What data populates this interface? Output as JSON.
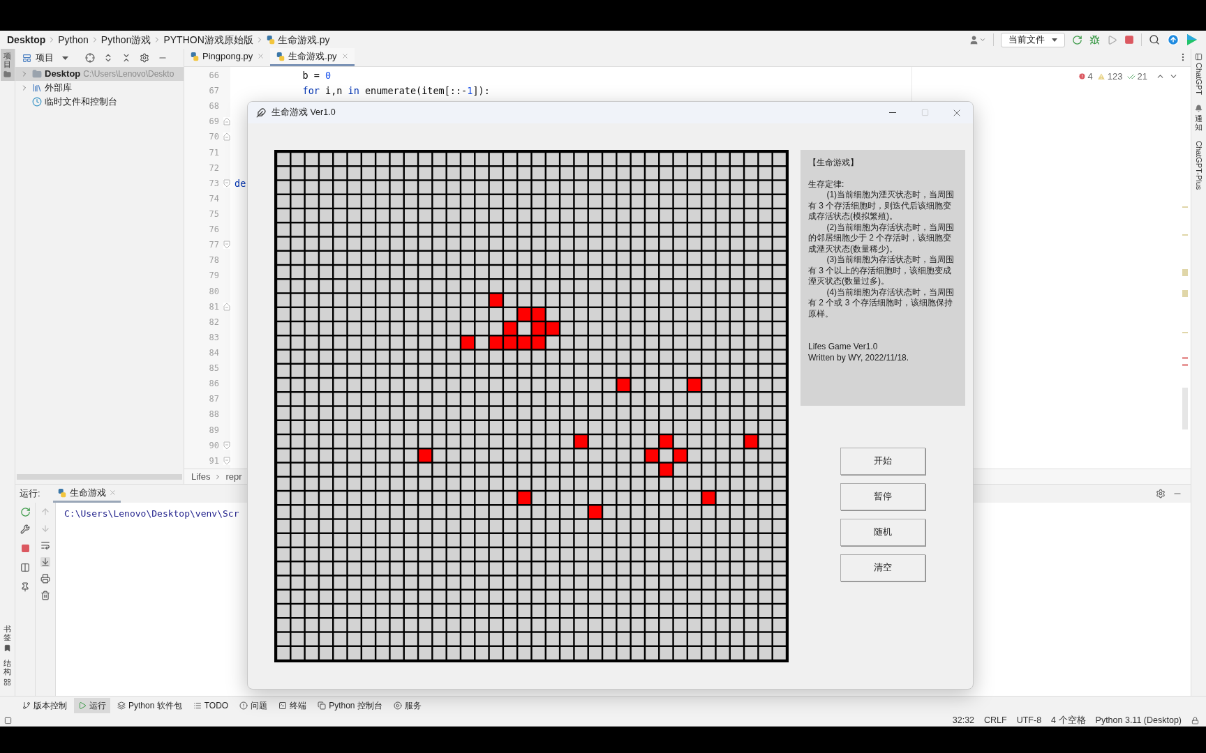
{
  "breadcrumb": [
    {
      "label": "Desktop"
    },
    {
      "label": "Python"
    },
    {
      "label": "Python游戏"
    },
    {
      "label": "PYTHON游戏原始版"
    },
    {
      "label": "生命游戏.py"
    }
  ],
  "toolbar": {
    "run_config": "当前文件"
  },
  "left_strip": {
    "top": [
      {
        "label": "项目",
        "selected": true
      }
    ],
    "bottom": [
      {
        "label": "书签"
      },
      {
        "label": "结构"
      }
    ]
  },
  "right_strip": [
    {
      "label": "ChatGPT",
      "kind": "rotated"
    },
    {
      "label": "通知",
      "kind": "stacked"
    },
    {
      "label": "ChatGPT-Plus",
      "kind": "rotated"
    }
  ],
  "project_panel": {
    "title": "项目",
    "tree": [
      {
        "label": "Desktop",
        "path": "C:\\Users\\Lenovo\\Deskto",
        "kind": "folder",
        "expanded": false,
        "selected": true
      },
      {
        "label": "外部库",
        "kind": "library",
        "expanded": false,
        "selected": false
      },
      {
        "label": "临时文件和控制台",
        "kind": "scratch",
        "selected": false
      }
    ]
  },
  "editor_tabs": [
    {
      "label": "Pingpong.py",
      "selected": false
    },
    {
      "label": "生命游戏.py",
      "selected": true
    }
  ],
  "inspections": {
    "errors": "4",
    "warnings": "123",
    "weak_warnings": "21"
  },
  "editor": {
    "lines": [
      {
        "number": "66",
        "tokens": [
          {
            "text": "            b = ",
            "kind": "plain"
          },
          {
            "text": "0",
            "kind": "number"
          }
        ]
      },
      {
        "number": "67",
        "tokens": [
          {
            "text": "            for ",
            "kind": "keyword"
          },
          {
            "text": "i,n ",
            "kind": "plain"
          },
          {
            "text": "in ",
            "kind": "keyword"
          },
          {
            "text": "enumerate(item[::-",
            "kind": "plain"
          },
          {
            "text": "1",
            "kind": "number"
          },
          {
            "text": "]):",
            "kind": "plain"
          }
        ]
      },
      {
        "number": "68"
      },
      {
        "number": "69",
        "fold_end": true
      },
      {
        "number": "70",
        "fold_end": true
      },
      {
        "number": "71"
      },
      {
        "number": "72"
      },
      {
        "number": "73",
        "fold_start": true,
        "tokens": [
          {
            "text": "de",
            "kind": "keyword"
          }
        ]
      },
      {
        "number": "74"
      },
      {
        "number": "75"
      },
      {
        "number": "76"
      },
      {
        "number": "77",
        "fold_start": true
      },
      {
        "number": "78"
      },
      {
        "number": "79"
      },
      {
        "number": "80"
      },
      {
        "number": "81",
        "fold_end": true
      },
      {
        "number": "82"
      },
      {
        "number": "83"
      },
      {
        "number": "84"
      },
      {
        "number": "85"
      },
      {
        "number": "86"
      },
      {
        "number": "87"
      },
      {
        "number": "88"
      },
      {
        "number": "89"
      },
      {
        "number": "90",
        "fold_start": true
      },
      {
        "number": "91",
        "fold_start": true
      }
    ],
    "breadcrumb": [
      "Lifes",
      "repr"
    ]
  },
  "run_panel": {
    "label": "运行:",
    "tab": "生命游戏",
    "output": "C:\\Users\\Lenovo\\Desktop\\venv\\Scr"
  },
  "tool_windows": [
    {
      "label": "版本控制",
      "selected": false
    },
    {
      "label": "运行",
      "selected": true
    },
    {
      "label": "Python 软件包",
      "selected": false
    },
    {
      "label": "TODO",
      "selected": false
    },
    {
      "label": "问题",
      "selected": false
    },
    {
      "label": "终端",
      "selected": false
    },
    {
      "label": "Python 控制台",
      "selected": false
    },
    {
      "label": "服务",
      "selected": false
    }
  ],
  "status_bar": [
    "32:32",
    "CRLF",
    "UTF-8",
    "4 个空格",
    "Python 3.11 (Desktop)"
  ],
  "dialog": {
    "title": "生命游戏 Ver1.0",
    "board": {
      "rows": [
        [
          false,
          false,
          false,
          false,
          false,
          false,
          false,
          false,
          false,
          false,
          false,
          false,
          false,
          false,
          false,
          false,
          false,
          false,
          false,
          false,
          false,
          false,
          false,
          false,
          false,
          false,
          false,
          false,
          false,
          false,
          false,
          false,
          false,
          false,
          false,
          false
        ],
        [
          false,
          false,
          false,
          false,
          false,
          false,
          false,
          false,
          false,
          false,
          false,
          false,
          false,
          false,
          false,
          false,
          false,
          false,
          false,
          false,
          false,
          false,
          false,
          false,
          false,
          false,
          false,
          false,
          false,
          false,
          false,
          false,
          false,
          false,
          false,
          false
        ],
        [
          false,
          false,
          false,
          false,
          false,
          false,
          false,
          false,
          false,
          false,
          false,
          false,
          false,
          false,
          false,
          false,
          false,
          false,
          false,
          false,
          false,
          false,
          false,
          false,
          false,
          false,
          false,
          false,
          false,
          false,
          false,
          false,
          false,
          false,
          false,
          false
        ],
        [
          false,
          false,
          false,
          false,
          false,
          false,
          false,
          false,
          false,
          false,
          false,
          false,
          false,
          false,
          false,
          false,
          false,
          false,
          false,
          false,
          false,
          false,
          false,
          false,
          false,
          false,
          false,
          false,
          false,
          false,
          false,
          false,
          false,
          false,
          false,
          false
        ],
        [
          false,
          false,
          false,
          false,
          false,
          false,
          false,
          false,
          false,
          false,
          false,
          false,
          false,
          false,
          false,
          false,
          false,
          false,
          false,
          false,
          false,
          false,
          false,
          false,
          false,
          false,
          false,
          false,
          false,
          false,
          false,
          false,
          false,
          false,
          false,
          false
        ],
        [
          false,
          false,
          false,
          false,
          false,
          false,
          false,
          false,
          false,
          false,
          false,
          false,
          false,
          false,
          false,
          false,
          false,
          false,
          false,
          false,
          false,
          false,
          false,
          false,
          false,
          false,
          false,
          false,
          false,
          false,
          false,
          false,
          false,
          false,
          false,
          false
        ],
        [
          false,
          false,
          false,
          false,
          false,
          false,
          false,
          false,
          false,
          false,
          false,
          false,
          false,
          false,
          false,
          false,
          false,
          false,
          false,
          false,
          false,
          false,
          false,
          false,
          false,
          false,
          false,
          false,
          false,
          false,
          false,
          false,
          false,
          false,
          false,
          false
        ],
        [
          false,
          false,
          false,
          false,
          false,
          false,
          false,
          false,
          false,
          false,
          false,
          false,
          false,
          false,
          false,
          false,
          false,
          false,
          false,
          false,
          false,
          false,
          false,
          false,
          false,
          false,
          false,
          false,
          false,
          false,
          false,
          false,
          false,
          false,
          false,
          false
        ],
        [
          false,
          false,
          false,
          false,
          false,
          false,
          false,
          false,
          false,
          false,
          false,
          false,
          false,
          false,
          false,
          false,
          false,
          false,
          false,
          false,
          false,
          false,
          false,
          false,
          false,
          false,
          false,
          false,
          false,
          false,
          false,
          false,
          false,
          false,
          false,
          false
        ],
        [
          false,
          false,
          false,
          false,
          false,
          false,
          false,
          false,
          false,
          false,
          false,
          false,
          false,
          false,
          false,
          false,
          false,
          false,
          false,
          false,
          false,
          false,
          false,
          false,
          false,
          false,
          false,
          false,
          false,
          false,
          false,
          false,
          false,
          false,
          false,
          false
        ],
        [
          false,
          false,
          false,
          false,
          false,
          false,
          false,
          false,
          false,
          false,
          false,
          false,
          false,
          false,
          false,
          true,
          false,
          false,
          false,
          false,
          false,
          false,
          false,
          false,
          false,
          false,
          false,
          false,
          false,
          false,
          false,
          false,
          false,
          false,
          false,
          false
        ],
        [
          false,
          false,
          false,
          false,
          false,
          false,
          false,
          false,
          false,
          false,
          false,
          false,
          false,
          false,
          false,
          false,
          false,
          true,
          true,
          false,
          false,
          false,
          false,
          false,
          false,
          false,
          false,
          false,
          false,
          false,
          false,
          false,
          false,
          false,
          false,
          false
        ],
        [
          false,
          false,
          false,
          false,
          false,
          false,
          false,
          false,
          false,
          false,
          false,
          false,
          false,
          false,
          false,
          false,
          true,
          false,
          true,
          true,
          false,
          false,
          false,
          false,
          false,
          false,
          false,
          false,
          false,
          false,
          false,
          false,
          false,
          false,
          false,
          false
        ],
        [
          false,
          false,
          false,
          false,
          false,
          false,
          false,
          false,
          false,
          false,
          false,
          false,
          false,
          true,
          false,
          true,
          true,
          true,
          true,
          false,
          false,
          false,
          false,
          false,
          false,
          false,
          false,
          false,
          false,
          false,
          false,
          false,
          false,
          false,
          false,
          false
        ],
        [
          false,
          false,
          false,
          false,
          false,
          false,
          false,
          false,
          false,
          false,
          false,
          false,
          false,
          false,
          false,
          false,
          false,
          false,
          false,
          false,
          false,
          false,
          false,
          false,
          false,
          false,
          false,
          false,
          false,
          false,
          false,
          false,
          false,
          false,
          false,
          false
        ],
        [
          false,
          false,
          false,
          false,
          false,
          false,
          false,
          false,
          false,
          false,
          false,
          false,
          false,
          false,
          false,
          false,
          false,
          false,
          false,
          false,
          false,
          false,
          false,
          false,
          false,
          false,
          false,
          false,
          false,
          false,
          false,
          false,
          false,
          false,
          false,
          false
        ],
        [
          false,
          false,
          false,
          false,
          false,
          false,
          false,
          false,
          false,
          false,
          false,
          false,
          false,
          false,
          false,
          false,
          false,
          false,
          false,
          false,
          false,
          false,
          false,
          false,
          true,
          false,
          false,
          false,
          false,
          true,
          false,
          false,
          false,
          false,
          false,
          false
        ],
        [
          false,
          false,
          false,
          false,
          false,
          false,
          false,
          false,
          false,
          false,
          false,
          false,
          false,
          false,
          false,
          false,
          false,
          false,
          false,
          false,
          false,
          false,
          false,
          false,
          false,
          false,
          false,
          false,
          false,
          false,
          false,
          false,
          false,
          false,
          false,
          false
        ],
        [
          false,
          false,
          false,
          false,
          false,
          false,
          false,
          false,
          false,
          false,
          false,
          false,
          false,
          false,
          false,
          false,
          false,
          false,
          false,
          false,
          false,
          false,
          false,
          false,
          false,
          false,
          false,
          false,
          false,
          false,
          false,
          false,
          false,
          false,
          false,
          false
        ],
        [
          false,
          false,
          false,
          false,
          false,
          false,
          false,
          false,
          false,
          false,
          false,
          false,
          false,
          false,
          false,
          false,
          false,
          false,
          false,
          false,
          false,
          false,
          false,
          false,
          false,
          false,
          false,
          false,
          false,
          false,
          false,
          false,
          false,
          false,
          false,
          false
        ],
        [
          false,
          false,
          false,
          false,
          false,
          false,
          false,
          false,
          false,
          false,
          false,
          false,
          false,
          false,
          false,
          false,
          false,
          false,
          false,
          false,
          false,
          true,
          false,
          false,
          false,
          false,
          false,
          true,
          false,
          false,
          false,
          false,
          false,
          true,
          false,
          false
        ],
        [
          false,
          false,
          false,
          false,
          false,
          false,
          false,
          false,
          false,
          false,
          true,
          false,
          false,
          false,
          false,
          false,
          false,
          false,
          false,
          false,
          false,
          false,
          false,
          false,
          false,
          false,
          true,
          false,
          true,
          false,
          false,
          false,
          false,
          false,
          false,
          false
        ],
        [
          false,
          false,
          false,
          false,
          false,
          false,
          false,
          false,
          false,
          false,
          false,
          false,
          false,
          false,
          false,
          false,
          false,
          false,
          false,
          false,
          false,
          false,
          false,
          false,
          false,
          false,
          false,
          true,
          false,
          false,
          false,
          false,
          false,
          false,
          false,
          false
        ],
        [
          false,
          false,
          false,
          false,
          false,
          false,
          false,
          false,
          false,
          false,
          false,
          false,
          false,
          false,
          false,
          false,
          false,
          false,
          false,
          false,
          false,
          false,
          false,
          false,
          false,
          false,
          false,
          false,
          false,
          false,
          false,
          false,
          false,
          false,
          false,
          false
        ],
        [
          false,
          false,
          false,
          false,
          false,
          false,
          false,
          false,
          false,
          false,
          false,
          false,
          false,
          false,
          false,
          false,
          false,
          true,
          false,
          false,
          false,
          false,
          false,
          false,
          false,
          false,
          false,
          false,
          false,
          false,
          true,
          false,
          false,
          false,
          false,
          false
        ],
        [
          false,
          false,
          false,
          false,
          false,
          false,
          false,
          false,
          false,
          false,
          false,
          false,
          false,
          false,
          false,
          false,
          false,
          false,
          false,
          false,
          false,
          false,
          true,
          false,
          false,
          false,
          false,
          false,
          false,
          false,
          false,
          false,
          false,
          false,
          false,
          false
        ],
        [
          false,
          false,
          false,
          false,
          false,
          false,
          false,
          false,
          false,
          false,
          false,
          false,
          false,
          false,
          false,
          false,
          false,
          false,
          false,
          false,
          false,
          false,
          false,
          false,
          false,
          false,
          false,
          false,
          false,
          false,
          false,
          false,
          false,
          false,
          false,
          false
        ],
        [
          false,
          false,
          false,
          false,
          false,
          false,
          false,
          false,
          false,
          false,
          false,
          false,
          false,
          false,
          false,
          false,
          false,
          false,
          false,
          false,
          false,
          false,
          false,
          false,
          false,
          false,
          false,
          false,
          false,
          false,
          false,
          false,
          false,
          false,
          false,
          false
        ],
        [
          false,
          false,
          false,
          false,
          false,
          false,
          false,
          false,
          false,
          false,
          false,
          false,
          false,
          false,
          false,
          false,
          false,
          false,
          false,
          false,
          false,
          false,
          false,
          false,
          false,
          false,
          false,
          false,
          false,
          false,
          false,
          false,
          false,
          false,
          false,
          false
        ],
        [
          false,
          false,
          false,
          false,
          false,
          false,
          false,
          false,
          false,
          false,
          false,
          false,
          false,
          false,
          false,
          false,
          false,
          false,
          false,
          false,
          false,
          false,
          false,
          false,
          false,
          false,
          false,
          false,
          false,
          false,
          false,
          false,
          false,
          false,
          false,
          false
        ],
        [
          false,
          false,
          false,
          false,
          false,
          false,
          false,
          false,
          false,
          false,
          false,
          false,
          false,
          false,
          false,
          false,
          false,
          false,
          false,
          false,
          false,
          false,
          false,
          false,
          false,
          false,
          false,
          false,
          false,
          false,
          false,
          false,
          false,
          false,
          false,
          false
        ],
        [
          false,
          false,
          false,
          false,
          false,
          false,
          false,
          false,
          false,
          false,
          false,
          false,
          false,
          false,
          false,
          false,
          false,
          false,
          false,
          false,
          false,
          false,
          false,
          false,
          false,
          false,
          false,
          false,
          false,
          false,
          false,
          false,
          false,
          false,
          false,
          false
        ],
        [
          false,
          false,
          false,
          false,
          false,
          false,
          false,
          false,
          false,
          false,
          false,
          false,
          false,
          false,
          false,
          false,
          false,
          false,
          false,
          false,
          false,
          false,
          false,
          false,
          false,
          false,
          false,
          false,
          false,
          false,
          false,
          false,
          false,
          false,
          false,
          false
        ],
        [
          false,
          false,
          false,
          false,
          false,
          false,
          false,
          false,
          false,
          false,
          false,
          false,
          false,
          false,
          false,
          false,
          false,
          false,
          false,
          false,
          false,
          false,
          false,
          false,
          false,
          false,
          false,
          false,
          false,
          false,
          false,
          false,
          false,
          false,
          false,
          false
        ],
        [
          false,
          false,
          false,
          false,
          false,
          false,
          false,
          false,
          false,
          false,
          false,
          false,
          false,
          false,
          false,
          false,
          false,
          false,
          false,
          false,
          false,
          false,
          false,
          false,
          false,
          false,
          false,
          false,
          false,
          false,
          false,
          false,
          false,
          false,
          false,
          false
        ],
        [
          false,
          false,
          false,
          false,
          false,
          false,
          false,
          false,
          false,
          false,
          false,
          false,
          false,
          false,
          false,
          false,
          false,
          false,
          false,
          false,
          false,
          false,
          false,
          false,
          false,
          false,
          false,
          false,
          false,
          false,
          false,
          false,
          false,
          false,
          false,
          false
        ]
      ]
    },
    "info": {
      "heading": "【生命游戏】",
      "subheading": "生存定律:",
      "rules": [
        "(1)当前细胞为湮灭状态时，当周围有 3 个存活细胞时，则迭代后该细胞变成存活状态(模拟繁殖)。",
        "(2)当前细胞为存活状态时，当周围的邻居细胞少于 2 个存活时，该细胞变成湮灭状态(数量稀少)。",
        "(3)当前细胞为存活状态时，当周围有 3 个以上的存活细胞时，该细胞变成湮灭状态(数量过多)。",
        "(4)当前细胞为存活状态时，当周围有 2 个或 3 个存活细胞时，该细胞保持原样。"
      ],
      "footer": [
        "Lifes Game Ver1.0",
        "Written by WY, 2022/11/18."
      ]
    },
    "buttons": [
      "开始",
      "暂停",
      "随机",
      "清空"
    ]
  }
}
